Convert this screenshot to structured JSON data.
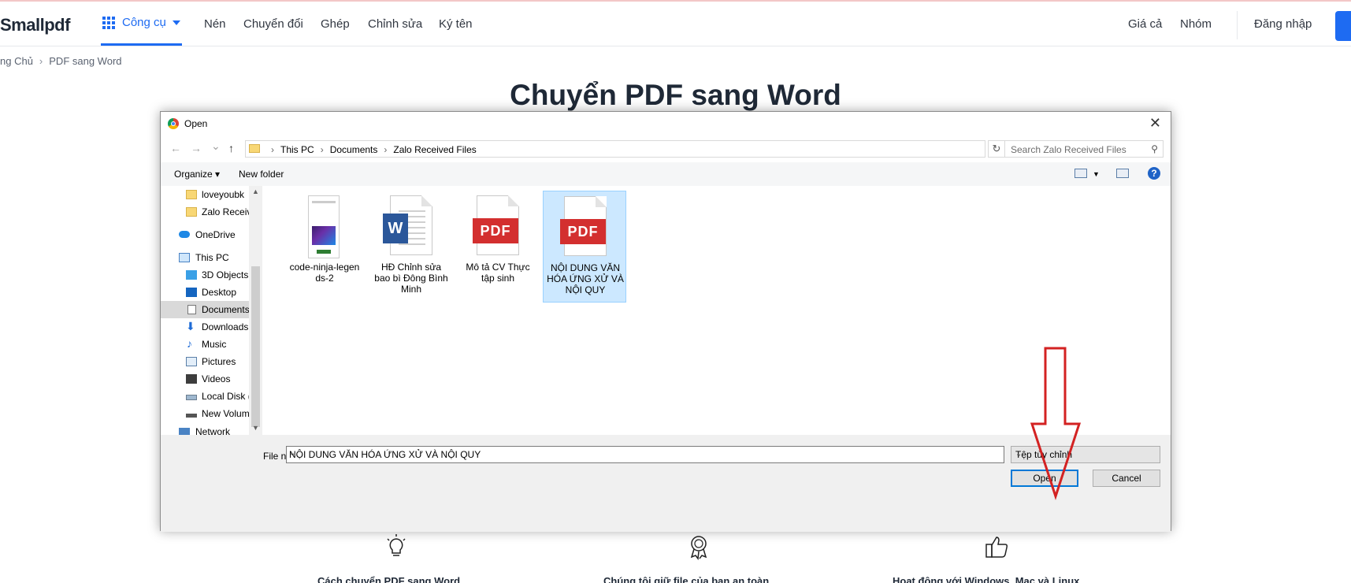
{
  "nav": {
    "logo": "Smallpdf",
    "tools_label": "Công cụ",
    "links": [
      "Nén",
      "Chuyển đổi",
      "Ghép",
      "Chỉnh sửa",
      "Ký tên"
    ],
    "right_links": [
      "Giá cả",
      "Nhóm"
    ],
    "login": "Đăng nhập",
    "accent_color": "#1e6bf2"
  },
  "breadcrumb": {
    "home": "ng Chủ",
    "separator": "›",
    "current": "PDF sang Word"
  },
  "page_title": "Chuyển PDF sang Word",
  "features": [
    {
      "icon": "lightbulb-icon",
      "text": "Cách chuyển PDF sang Word"
    },
    {
      "icon": "award-icon",
      "text": "Chúng tôi giữ file của bạn an toàn"
    },
    {
      "icon": "thumbs-up-icon",
      "text": "Hoạt động với Windows, Mac và Linux"
    }
  ],
  "dialog": {
    "title": "Open",
    "close": "✕",
    "back": "←",
    "forward": "→",
    "recent": "⌄",
    "up": "↑",
    "path": [
      "This PC",
      "Documents",
      "Zalo Received Files"
    ],
    "search_placeholder": "Search Zalo Received Files",
    "organize": "Organize ▾",
    "new_folder": "New folder",
    "help": "?",
    "sidebar": [
      {
        "label": "loveyoubk",
        "icon": "folder-icon"
      },
      {
        "label": "Zalo Received",
        "icon": "folder-icon"
      },
      {
        "label": "OneDrive",
        "icon": "cloud-icon"
      },
      {
        "label": "This PC",
        "icon": "computer-icon"
      },
      {
        "label": "3D Objects",
        "icon": "cube-icon"
      },
      {
        "label": "Desktop",
        "icon": "desktop-icon"
      },
      {
        "label": "Documents",
        "icon": "document-icon"
      },
      {
        "label": "Downloads",
        "icon": "download-icon"
      },
      {
        "label": "Music",
        "icon": "music-icon"
      },
      {
        "label": "Pictures",
        "icon": "pictures-icon"
      },
      {
        "label": "Videos",
        "icon": "videos-icon"
      },
      {
        "label": "Local Disk (C",
        "icon": "disk-icon"
      },
      {
        "label": "New Volume",
        "icon": "drive-icon"
      },
      {
        "label": "Network",
        "icon": "network-icon"
      }
    ],
    "files": [
      {
        "name_l1": "code-ninja-legen",
        "name_l2": "ds-2",
        "name_l3": "",
        "type": "image"
      },
      {
        "name_l1": "HĐ Chỉnh sửa",
        "name_l2": "bao bì Đông Bình",
        "name_l3": "Minh",
        "type": "word"
      },
      {
        "name_l1": "Mô tả CV Thực",
        "name_l2": "tập sinh",
        "name_l3": "",
        "type": "pdf"
      },
      {
        "name_l1": "NỘI DUNG VĂN",
        "name_l2": "HÓA ỨNG XỬ VÀ",
        "name_l3": "NỘI QUY",
        "type": "pdf"
      }
    ],
    "pdf_badge": "PDF",
    "word_badge": "W",
    "file_name_label": "File name:",
    "file_name_value": "NỘI DUNG VĂN HÓA ỨNG XỬ VÀ NỘI QUY",
    "file_type": "Tệp tùy chỉnh",
    "open_button": "Open",
    "cancel_button": "Cancel"
  }
}
